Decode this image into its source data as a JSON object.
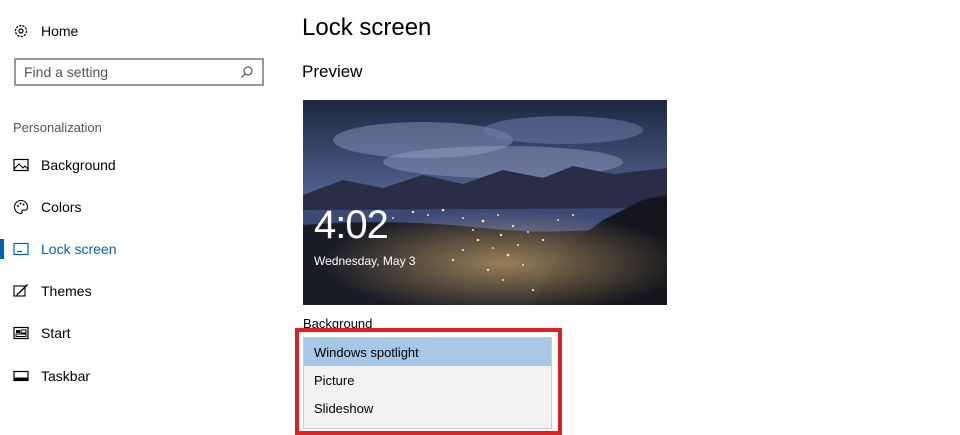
{
  "sidebar": {
    "home_label": "Home",
    "search_placeholder": "Find a setting",
    "section_label": "Personalization",
    "items": [
      {
        "label": "Background",
        "icon": "picture-icon"
      },
      {
        "label": "Colors",
        "icon": "palette-icon"
      },
      {
        "label": "Lock screen",
        "icon": "lock-screen-icon",
        "active": true
      },
      {
        "label": "Themes",
        "icon": "brush-icon"
      },
      {
        "label": "Start",
        "icon": "start-icon"
      },
      {
        "label": "Taskbar",
        "icon": "taskbar-icon"
      }
    ]
  },
  "main": {
    "title": "Lock screen",
    "preview_heading": "Preview",
    "preview": {
      "time": "4:02",
      "date": "Wednesday, May 3"
    },
    "background_label": "Background",
    "background_options": [
      "Windows spotlight",
      "Picture",
      "Slideshow"
    ],
    "selected_option": "Windows spotlight"
  },
  "colors": {
    "accent": "#0063b1",
    "highlight_border": "#e02020",
    "selected_option_bg": "#a6c8e6"
  }
}
